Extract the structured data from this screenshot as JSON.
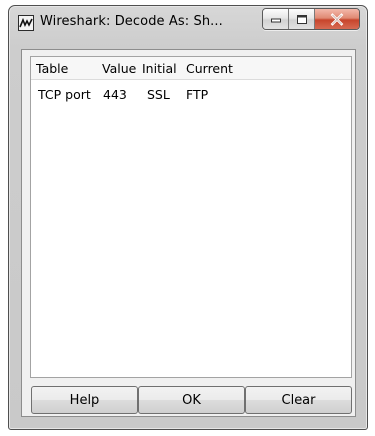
{
  "window": {
    "title": "Wireshark: Decode As: Sh..."
  },
  "table": {
    "columns": [
      "Table",
      "Value",
      "Initial",
      "Current"
    ],
    "rows": [
      {
        "table": "TCP port",
        "value": "443",
        "initial": "SSL",
        "current": "FTP"
      }
    ]
  },
  "buttons": {
    "help": "Help",
    "ok": "OK",
    "clear": "Clear"
  },
  "icons": {
    "app": "wireshark-icon",
    "minimize": "minimize-icon",
    "maximize": "maximize-icon",
    "close": "close-icon"
  }
}
